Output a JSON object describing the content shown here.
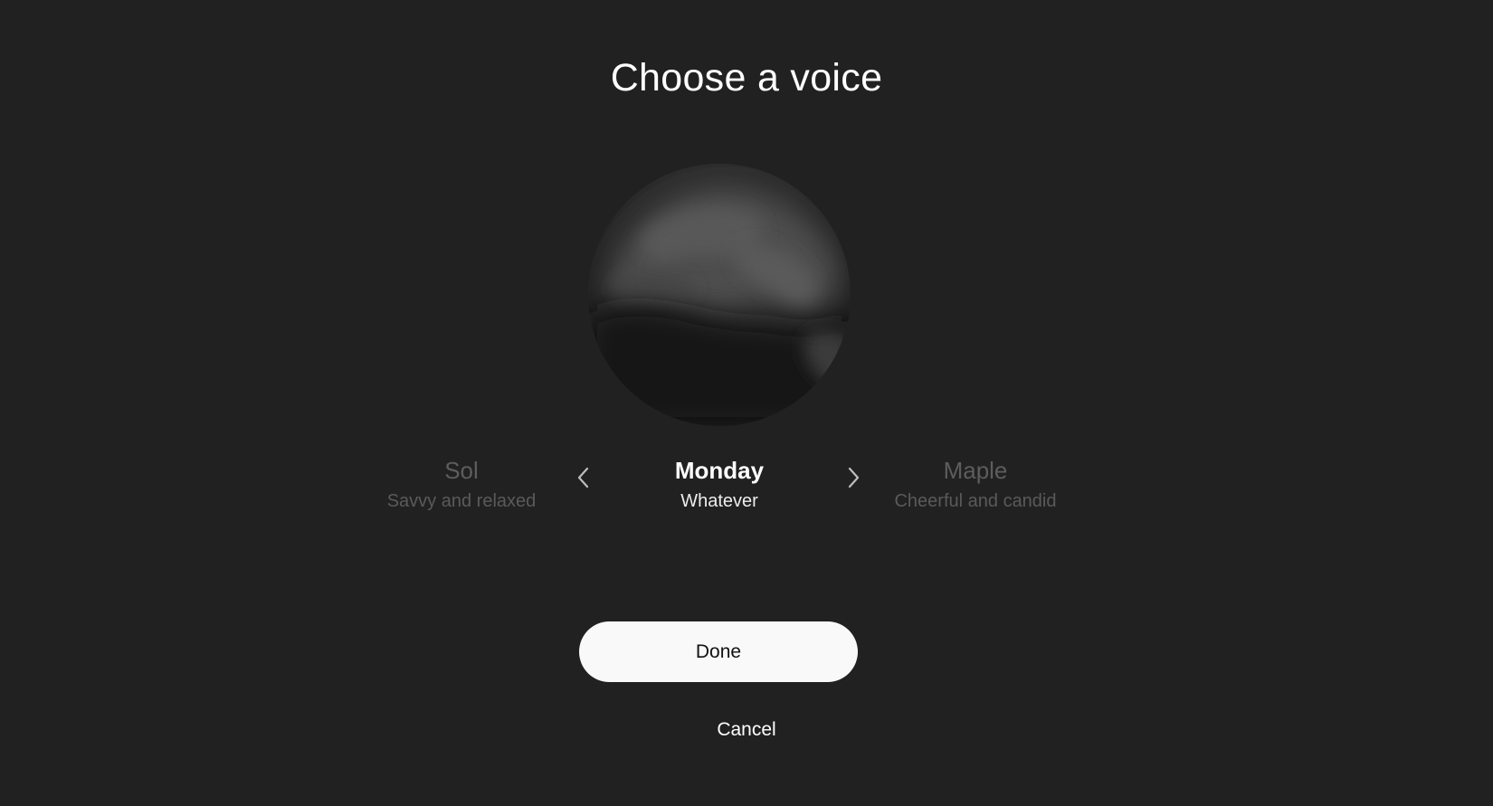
{
  "dialog": {
    "title": "Choose a voice"
  },
  "voices": {
    "previous": {
      "name": "Sol",
      "description": "Savvy and relaxed"
    },
    "current": {
      "name": "Monday",
      "description": "Whatever"
    },
    "next": {
      "name": "Maple",
      "description": "Cheerful and candid"
    }
  },
  "navigation": {
    "prev_icon": "chevron-left-icon",
    "next_icon": "chevron-right-icon"
  },
  "actions": {
    "done_label": "Done",
    "cancel_label": "Cancel"
  },
  "colors": {
    "background": "#212121",
    "button_bg": "#f9f9f9",
    "dim_text": "#5d5d5d"
  }
}
